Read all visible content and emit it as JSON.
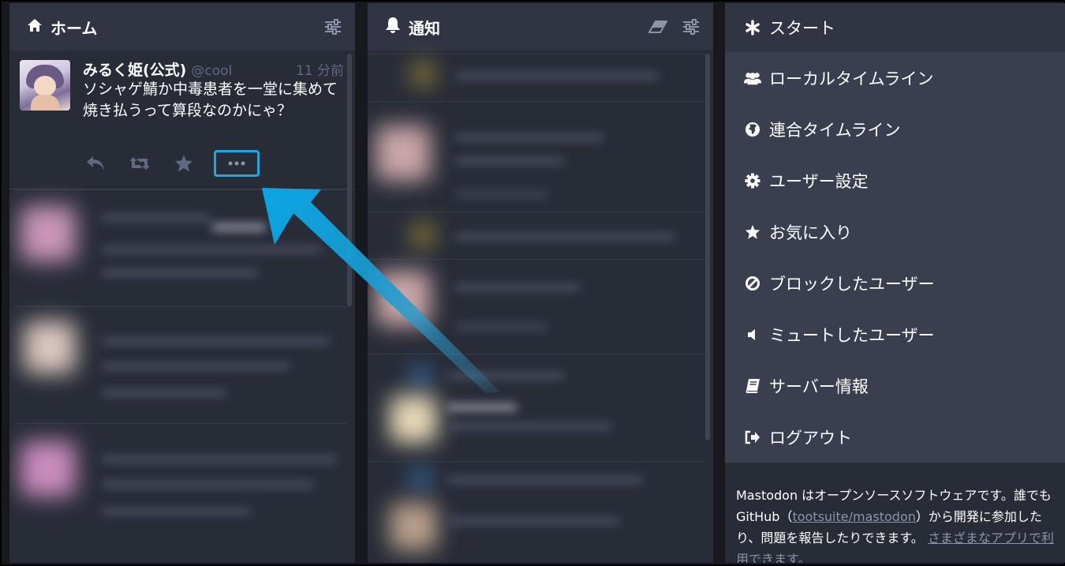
{
  "home_column": {
    "title": "ホーム",
    "toot": {
      "display_name": "みるく姫(公式)",
      "acct": "@cool",
      "time": "11 分前",
      "content": "ソシャゲ鯖か中毒患者を一堂に集めて焼き払うって算段なのかにゃ？"
    }
  },
  "notifications_column": {
    "title": "通知"
  },
  "nav_column": {
    "items": [
      {
        "label": "スタート",
        "icon": "asterisk-icon"
      },
      {
        "label": "ローカルタイムライン",
        "icon": "users-icon"
      },
      {
        "label": "連合タイムライン",
        "icon": "globe-icon"
      },
      {
        "label": "ユーザー設定",
        "icon": "gear-icon"
      },
      {
        "label": "お気に入り",
        "icon": "star-icon"
      },
      {
        "label": "ブロックしたユーザー",
        "icon": "ban-icon"
      },
      {
        "label": "ミュートしたユーザー",
        "icon": "volume-off-icon"
      },
      {
        "label": "サーバー情報",
        "icon": "book-icon"
      },
      {
        "label": "ログアウト",
        "icon": "sign-out-icon"
      }
    ],
    "footer": {
      "text_1": "Mastodon はオープンソースソフトウェアです。誰でも GitHub（",
      "link_repo": "tootsuite/mastodon",
      "text_2": "）から開発に参加したり、問題を報告したりできます。",
      "link_apps": "さまざまなアプリで利用できます。"
    }
  },
  "colors": {
    "background": "#17191f",
    "column": "#282c37",
    "header": "#313543",
    "nav_item": "#393f4f",
    "muted_text": "#606984",
    "highlight": "#1ca7e0"
  }
}
